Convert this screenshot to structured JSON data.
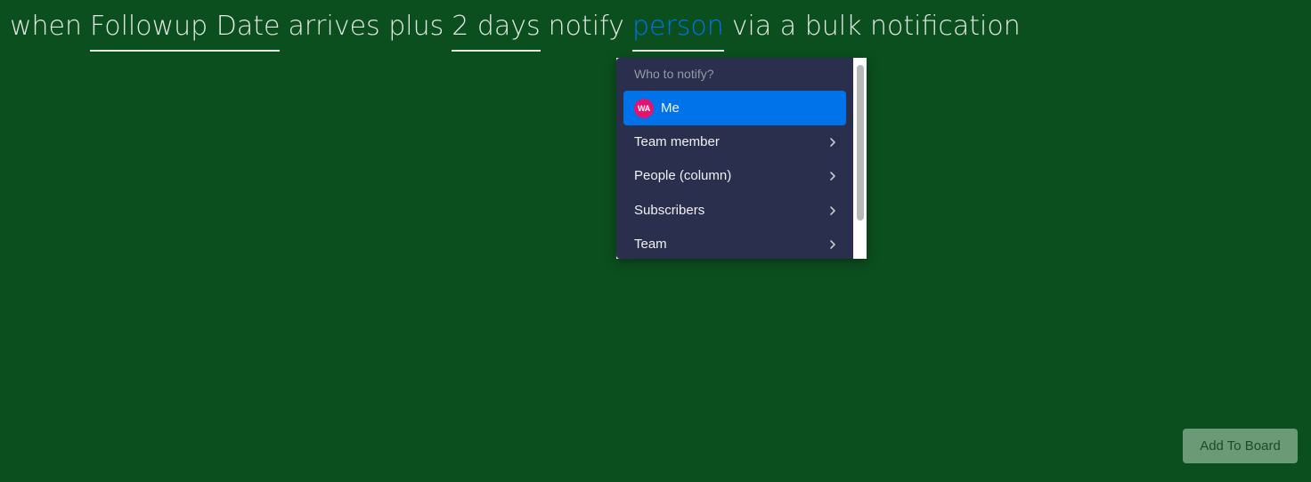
{
  "sentence": {
    "when": "when",
    "trigger_column": "Followup Date",
    "arrives_plus": "arrives plus",
    "offset": "2 days",
    "notify": "notify",
    "recipient": "person",
    "suffix": "via a bulk notification"
  },
  "dropdown": {
    "title": "Who to notify?",
    "options": [
      {
        "label": "Me",
        "avatar_initials": "WA",
        "selected": true
      },
      {
        "label": "Team member",
        "has_submenu": true
      },
      {
        "label": "People (column)",
        "has_submenu": true
      },
      {
        "label": "Subscribers",
        "has_submenu": true
      },
      {
        "label": "Team",
        "has_submenu": true
      }
    ]
  },
  "actions": {
    "add_to_board": "Add To Board"
  },
  "colors": {
    "background": "#0b4f1f",
    "accent": "#0073ea",
    "dropdown_bg": "#292f4c",
    "avatar": "#e2146f",
    "button_bg": "#6b9a76"
  }
}
